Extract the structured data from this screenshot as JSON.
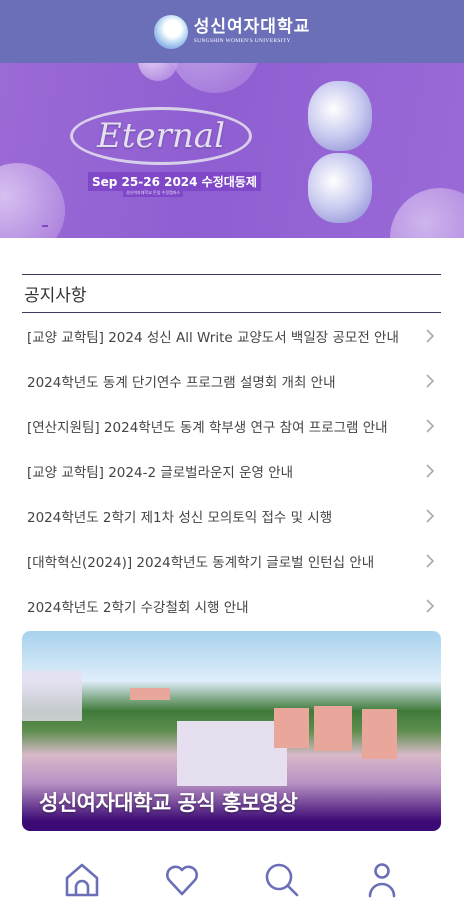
{
  "header": {
    "logo_ko": "성신여자대학교",
    "logo_en": "SUNGSHIN WOMEN'S UNIVERSITY"
  },
  "banner": {
    "title": "Eternal",
    "date": "Sep 25-26 2024 수정대동제",
    "subtitle": "성신여자대학교 돈암 수정캠퍼스",
    "slide_count": 4,
    "active_slide": 3,
    "active_dot_color": "#1e7cf5"
  },
  "notice": {
    "title": "공지사항",
    "items": [
      {
        "label": "[교양 교학팀] 2024 성신 All Write 교양도서 백일장 공모전 안내"
      },
      {
        "label": "2024학년도 동계 단기연수 프로그램 설명회 개최 안내"
      },
      {
        "label": "[연산지원팀] 2024학년도 동계 학부생 연구 참여 프로그램 안내"
      },
      {
        "label": "[교양 교학팀] 2024-2 글로벌라운지 운영 안내"
      },
      {
        "label": "2024학년도 2학기 제1차 성신 모의토익 접수 및 시행"
      },
      {
        "label": "[대학혁신(2024)] 2024학년도 동계학기 글로벌 인턴십 안내"
      },
      {
        "label": "2024학년도 2학기 수강철회 시행 안내"
      }
    ]
  },
  "promo": {
    "title_regular": "성신여자대학교",
    "title_bold": "공식 홍보영상"
  },
  "nav": {
    "icons": [
      "home-icon",
      "heart-icon",
      "search-icon",
      "user-icon"
    ],
    "color": "#6b6fb8"
  },
  "colors": {
    "header": "#6b6fb8",
    "banner": "#9366d4"
  }
}
